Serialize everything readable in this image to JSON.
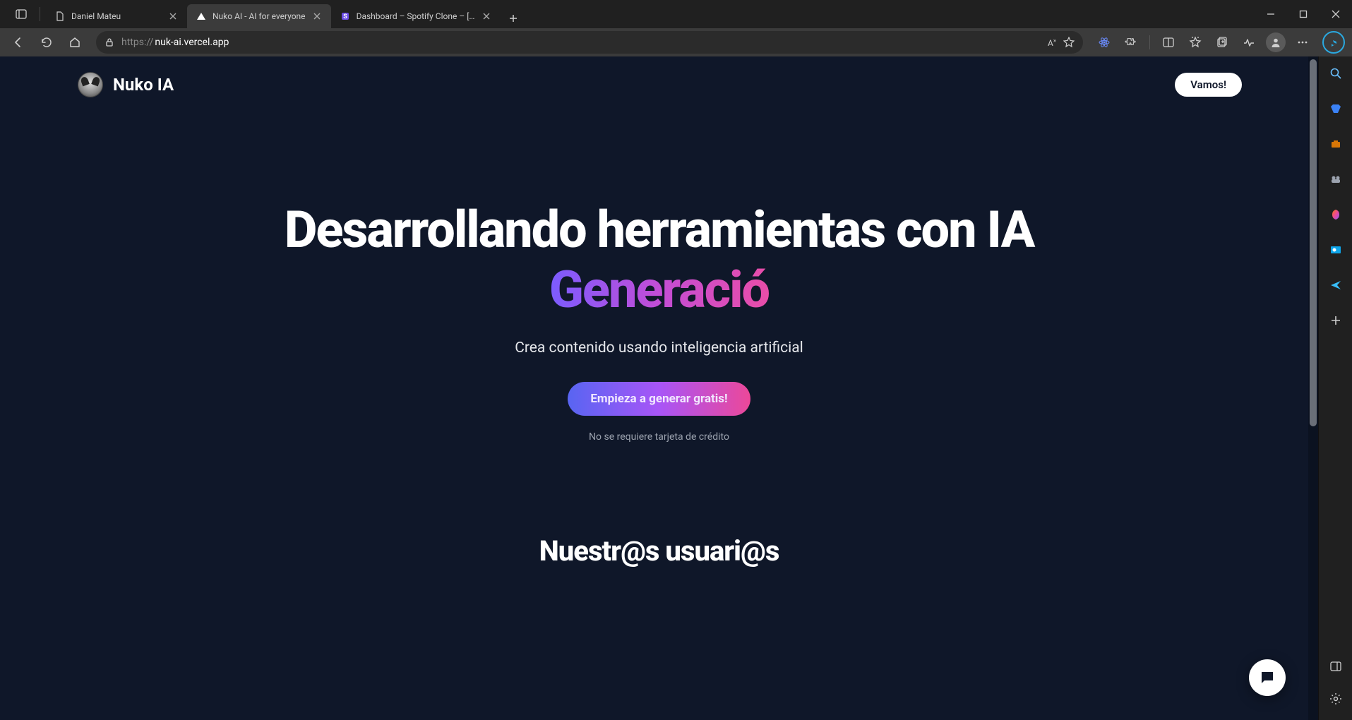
{
  "browser": {
    "tabs": [
      {
        "title": "Daniel Mateu",
        "active": false
      },
      {
        "title": "Nuko AI - AI for everyone",
        "active": true
      },
      {
        "title": "Dashboard – Spotify Clone – [Pr…",
        "active": false
      }
    ],
    "url_scheme": "https://",
    "url_host": "nuk-ai.vercel.app"
  },
  "site": {
    "brand": "Nuko IA",
    "cta_small": "Vamos!",
    "hero_title": "Desarrollando herramientas con IA",
    "hero_gradient": "Generació",
    "hero_sub": "Crea contenido usando inteligencia artificial",
    "hero_cta": "Empieza a generar gratis!",
    "hero_note": "No se requiere tarjeta de crédito",
    "section2_title": "Nuestr@s usuari@s"
  }
}
